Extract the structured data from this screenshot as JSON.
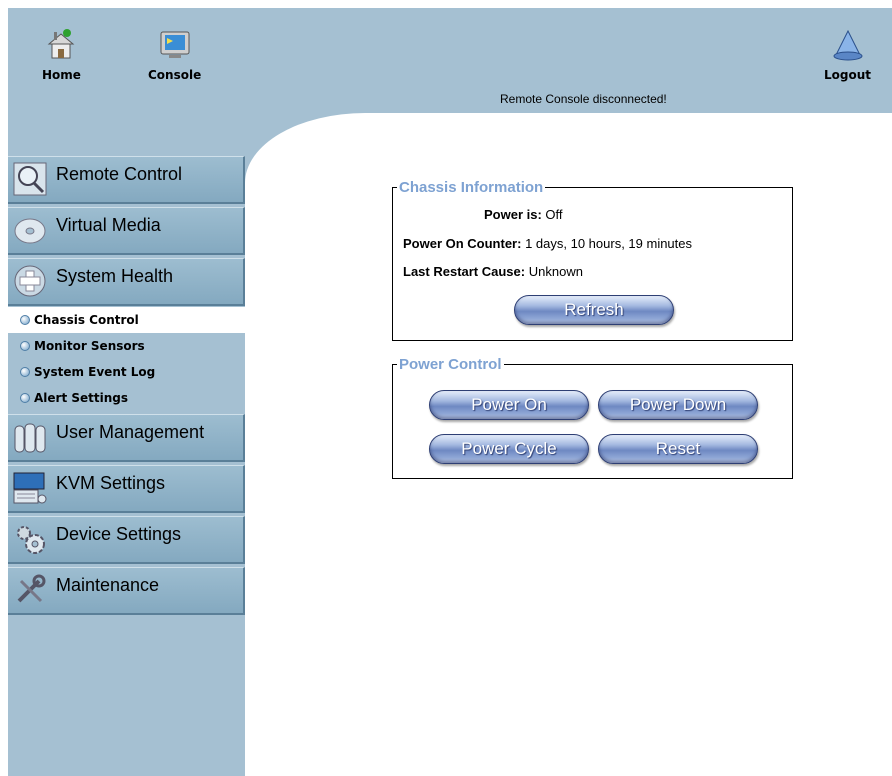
{
  "topnav": {
    "home_label": "Home",
    "console_label": "Console",
    "logout_label": "Logout",
    "status": "Remote Console disconnected!"
  },
  "sidebar": {
    "items": [
      {
        "label": "Remote Control",
        "icon": "magnifier-icon"
      },
      {
        "label": "Virtual Media",
        "icon": "disc-icon"
      },
      {
        "label": "System Health",
        "icon": "health-cross-icon"
      },
      {
        "label": "User Management",
        "icon": "users-icon"
      },
      {
        "label": "KVM Settings",
        "icon": "kvm-keyboard-icon"
      },
      {
        "label": "Device Settings",
        "icon": "gears-icon"
      },
      {
        "label": "Maintenance",
        "icon": "wrench-icon"
      }
    ],
    "subitems": [
      {
        "label": "Chassis Control",
        "active": true
      },
      {
        "label": "Monitor Sensors",
        "active": false
      },
      {
        "label": "System Event Log",
        "active": false
      },
      {
        "label": "Alert Settings",
        "active": false
      }
    ]
  },
  "chassis": {
    "legend": "Chassis Information",
    "power_key": "Power is:",
    "power_value": "Off",
    "counter_key": "Power On Counter:",
    "counter_value": "1 days, 10 hours, 19 minutes",
    "restart_key": "Last Restart Cause:",
    "restart_value": "Unknown",
    "refresh_label": "Refresh"
  },
  "power": {
    "legend": "Power Control",
    "power_on_label": "Power On",
    "power_down_label": "Power Down",
    "power_cycle_label": "Power Cycle",
    "reset_label": "Reset"
  },
  "colors": {
    "sidebar_bg": "#a5c0d2",
    "legend_text": "#7ea2d2",
    "button_blue": "#6e88c2"
  }
}
